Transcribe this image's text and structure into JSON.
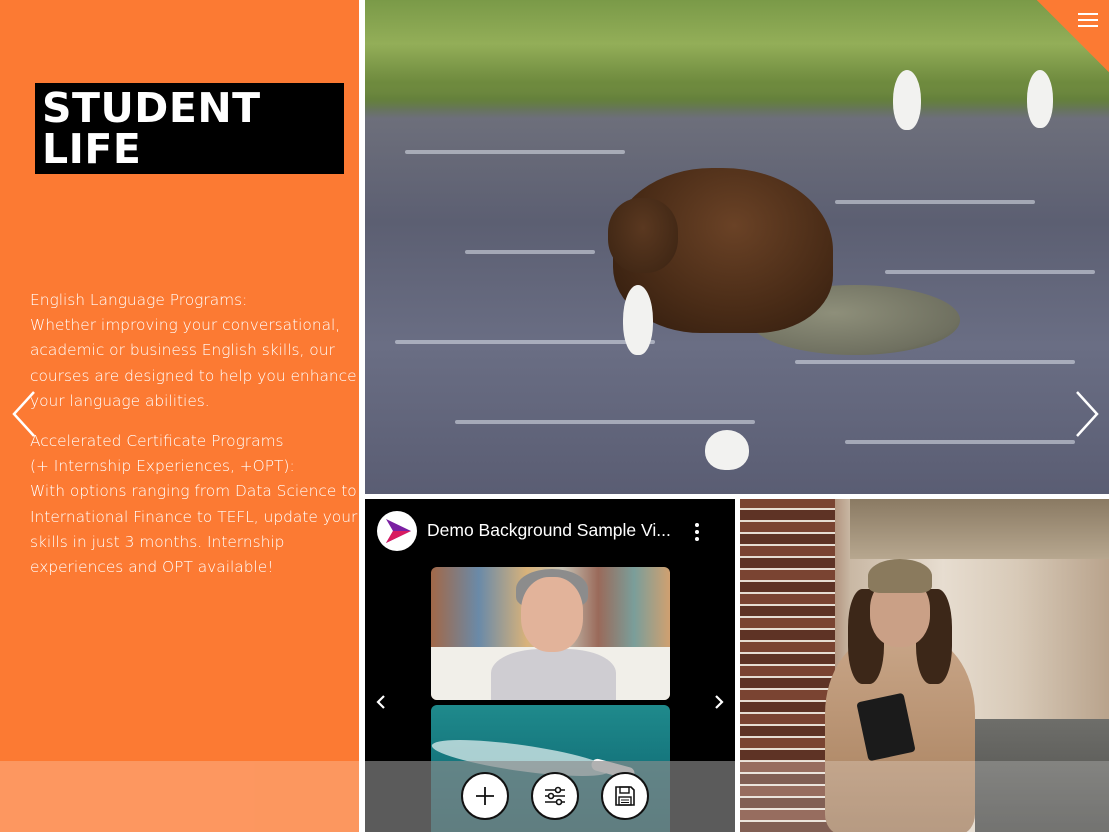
{
  "page": {
    "title_lines": [
      "STUDENT",
      "LIFE"
    ],
    "body": {
      "p1": "English Language Programs:",
      "p2": "Whether improving your conversational,",
      "p3": "academic or business English skills, our",
      "p4": "courses are designed to help you enhance",
      "p5": "your language abilities.",
      "p6": "Accelerated Certificate Programs",
      "p7": "(+ Internship Experiences, +OPT):",
      "p8": "With options ranging from Data Science to",
      "p9": "International Finance to TEFL, update your",
      "p10": "skills in just 3 months. Internship",
      "p11": "experiences and OPT available!"
    }
  },
  "video": {
    "title": "Demo Background Sample Vi..."
  },
  "toolbar": {
    "add_icon": "plus-icon",
    "adjust_icon": "sliders-icon",
    "save_icon": "floppy-disk-icon"
  },
  "icons": {
    "menu": "hamburger-menu-icon",
    "prev": "chevron-left-icon",
    "next": "chevron-right-icon",
    "kebab": "more-vertical-icon"
  },
  "colors": {
    "accent": "#fc7a33",
    "title_bg": "#000000",
    "text": "#ffffff"
  }
}
